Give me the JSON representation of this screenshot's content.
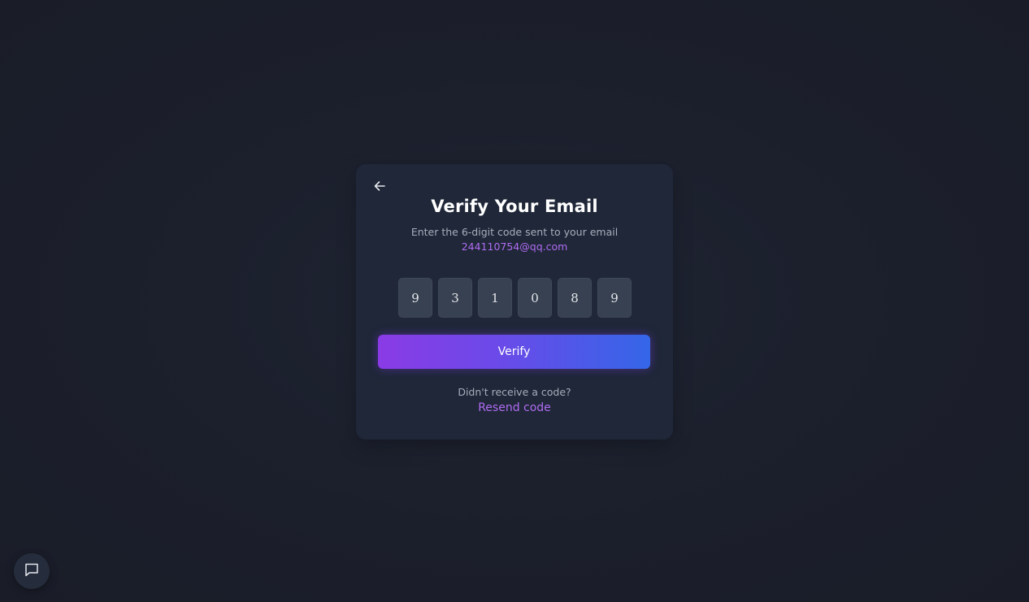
{
  "card": {
    "title": "Verify Your Email",
    "subtitle": "Enter the 6-digit code sent to your email",
    "email": "244110754@qq.com",
    "code_digits": [
      "9",
      "3",
      "1",
      "0",
      "8",
      "9"
    ],
    "verify_label": "Verify",
    "no_code_text": "Didn't receive a code?",
    "resend_label": "Resend code"
  },
  "icons": {
    "back": "arrow-left-icon",
    "chat": "chat-bubble-icon"
  },
  "colors": {
    "accent": "#b06cf2",
    "gradient_start": "#8a3be6",
    "gradient_end": "#3466e8"
  }
}
